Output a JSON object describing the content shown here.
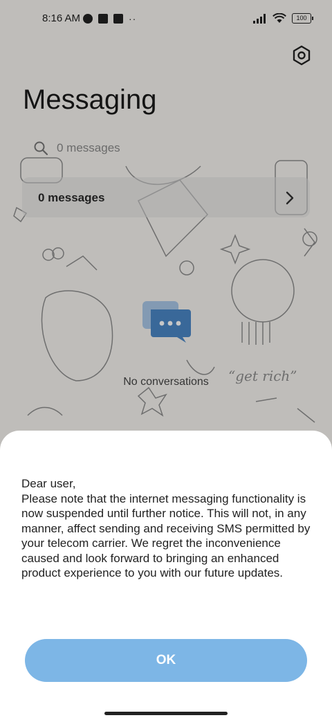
{
  "status_bar": {
    "time": "8:16 AM",
    "icons_left": [
      "app-notification-icon",
      "square-notification-icon",
      "upload-notification-icon"
    ],
    "more": "··",
    "icons_right": [
      "signal-icon",
      "wifi-icon",
      "battery-icon"
    ],
    "battery": "100"
  },
  "header": {
    "title": "Messaging",
    "settings_icon": "settings-icon"
  },
  "search": {
    "placeholder": "0 messages"
  },
  "summary": {
    "label": "0 messages"
  },
  "empty_state": {
    "label": "No conversations",
    "icon": "chat-bubble-icon",
    "icon_color": "#4a86c5"
  },
  "dialog": {
    "message": "Dear user,\nPlease note that the internet messaging functionality is now suspended until further notice. This will not, in any manner, affect sending and receiving SMS permitted by your telecom carrier. We regret the inconvenience caused and look forward to bringing an enhanced product experience to you with our future updates.",
    "ok_label": "OK",
    "button_color": "#7db6e6"
  },
  "background_doodle": {
    "text": "“get rich”"
  }
}
